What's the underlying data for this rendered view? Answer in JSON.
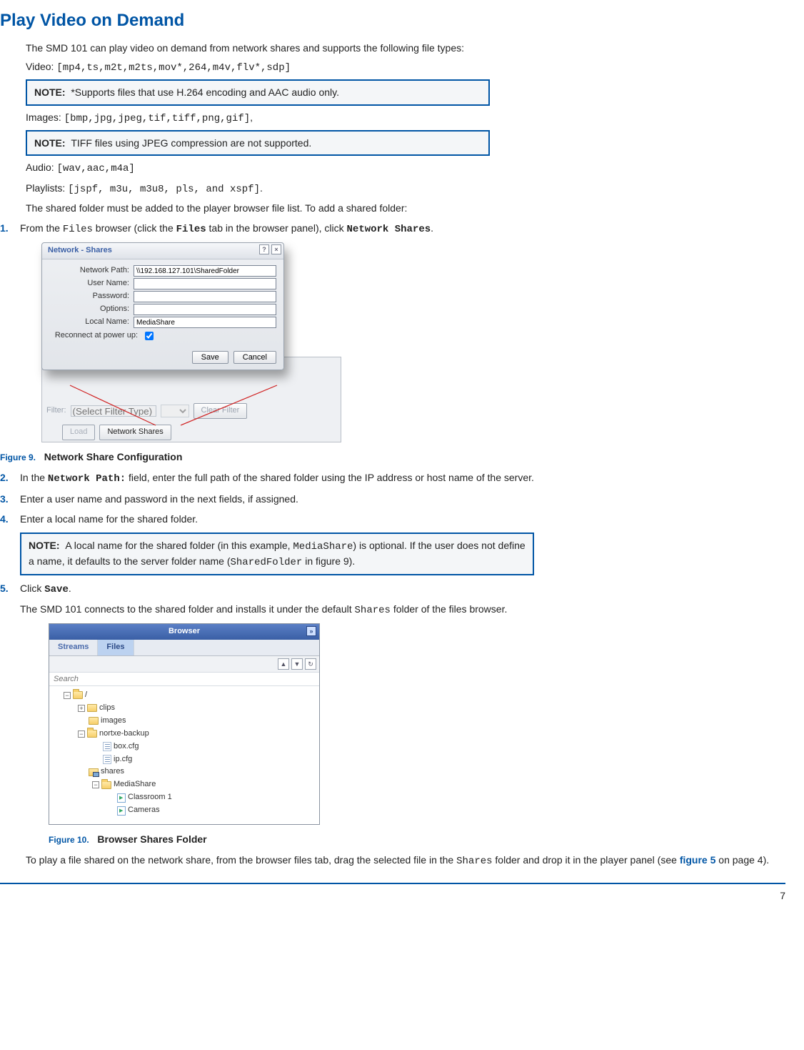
{
  "title": "Play Video on Demand",
  "intro": "The SMD 101 can play video on demand from network shares and supports the following file types:",
  "video_label": "Video: ",
  "video_formats": "[mp4,ts,m2t,m2ts,mov*,264,m4v,flv*,sdp]",
  "note_label": "NOTE:",
  "note1": "*Supports files that use H.264 encoding and AAC audio only.",
  "images_label": "Images: ",
  "images_formats": "[bmp,jpg,jpeg,tif,tiff,png,gif]",
  "images_trailing": ",",
  "note2": "TIFF files using JPEG compression are not supported.",
  "audio_label": "Audio: ",
  "audio_formats": "[wav,aac,m4a]",
  "playlists_label": "Playlists: ",
  "playlists_formats": "[jspf, m3u, m3u8, pls, and xspf]",
  "playlists_trailing": ".",
  "shared_intro": "The shared folder must be added to the player browser file list. To add a shared folder:",
  "step1_pre": "From the ",
  "step1_files": "Files",
  "step1_mid": " browser (click the ",
  "step1_files_bold": "Files",
  "step1_mid2": " tab in the browser panel), click ",
  "step1_ns": "Network Shares",
  "step1_end": ".",
  "dialog": {
    "title": "Network - Shares",
    "network_path_label": "Network Path:",
    "network_path_value": "\\\\192.168.127.101\\SharedFolder",
    "user_name_label": "User Name:",
    "password_label": "Password:",
    "options_label": "Options:",
    "local_name_label": "Local Name:",
    "local_name_value": "MediaShare",
    "reconnect_label": "Reconnect at power up:",
    "save": "Save",
    "cancel": "Cancel"
  },
  "bgpanel": {
    "filter_label": "Filter:",
    "filter_placeholder": "(Select Filter Type)",
    "clear_filter": "Clear Filter",
    "load": "Load",
    "network_shares": "Network Shares"
  },
  "fig9_num": "Figure 9.",
  "fig9_title": "Network Share Configuration",
  "step2_pre": "In the ",
  "step2_field": "Network Path:",
  "step2_post": " field, enter the full path of the shared folder using the IP address or host name of the server.",
  "step3": "Enter a user name and password in the next fields, if assigned.",
  "step4": "Enter a local name for the shared folder.",
  "note3_a": "A local name for the shared folder (in this example, ",
  "note3_code1": "MediaShare",
  "note3_b": ") is optional. If the user does not define a name, it defaults to the server folder name (",
  "note3_code2": "SharedFolder",
  "note3_c": " in figure 9).",
  "step5_pre": "Click ",
  "step5_save": "Save",
  "step5_end": ".",
  "step5_para_a": "The SMD 101 connects to the shared folder and installs it under the default ",
  "step5_shares": "Shares",
  "step5_para_b": " folder of the files browser.",
  "browser": {
    "title": "Browser",
    "tab_streams": "Streams",
    "tab_files": "Files",
    "search_placeholder": "Search",
    "root": "/",
    "clips": "clips",
    "images": "images",
    "nortxe": "nortxe-backup",
    "boxcfg": "box.cfg",
    "ipcfg": "ip.cfg",
    "shares": "shares",
    "mediashare": "MediaShare",
    "classroom": "Classroom 1",
    "cameras": "Cameras"
  },
  "fig10_num": "Figure 10.",
  "fig10_title": "Browser Shares Folder",
  "closing_a": "To play a file shared on the network share, from the browser files tab, drag the selected file in the ",
  "closing_shares": "Shares",
  "closing_b": " folder and drop it in the player panel (see ",
  "closing_link": "figure 5",
  "closing_c": " on page 4).",
  "page_number": "7"
}
